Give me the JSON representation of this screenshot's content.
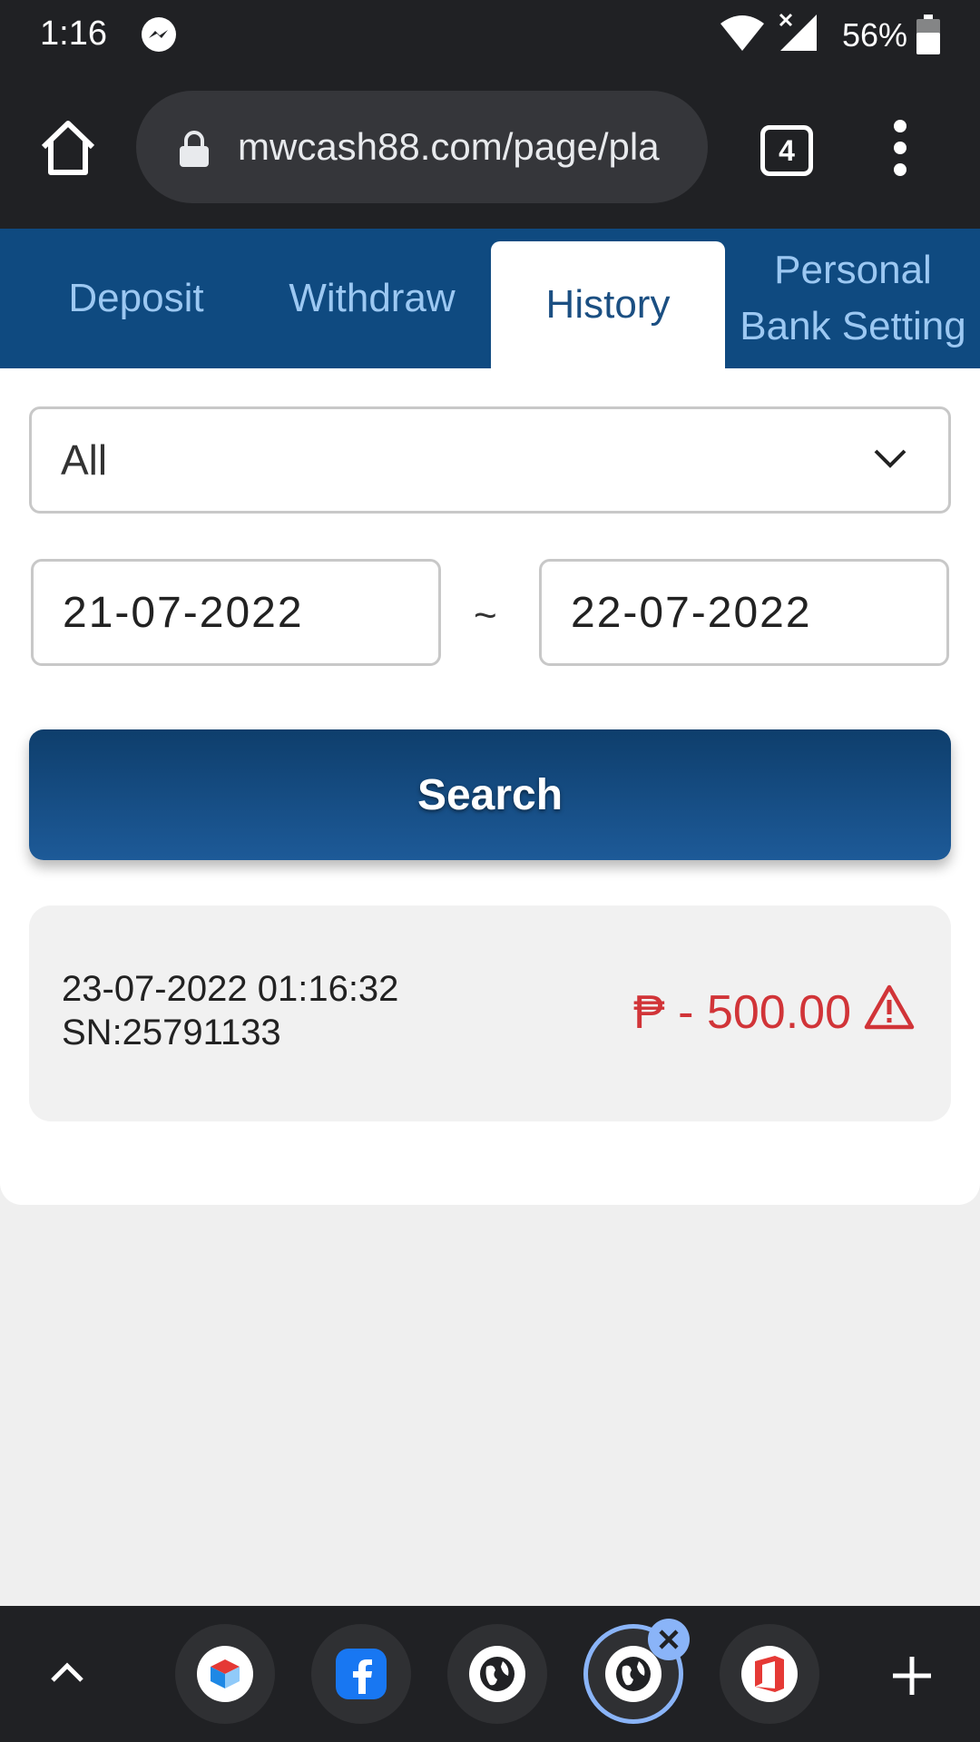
{
  "status_bar": {
    "time": "1:16",
    "battery": "56%",
    "icons": [
      "messenger-icon",
      "wifi-icon",
      "signal-icon",
      "battery-icon"
    ]
  },
  "browser": {
    "url": "mwcash88.com/page/pla",
    "tab_count": "4"
  },
  "tabs": [
    {
      "label": "Deposit",
      "active": false
    },
    {
      "label": "Withdraw",
      "active": false
    },
    {
      "label": "History",
      "active": true
    },
    {
      "label": "Personal Bank Setting",
      "active": false
    }
  ],
  "filter": {
    "type_selected": "All",
    "date_from": "21-07-2022",
    "date_separator": "~",
    "date_to": "22-07-2022",
    "search_label": "Search"
  },
  "records": [
    {
      "datetime": "23-07-2022 01:16:32",
      "sn": "SN:25791133",
      "amount": "₱ - 500.00",
      "status_icon": "warning-icon"
    }
  ],
  "colors": {
    "tab_bar": "#0f4a80",
    "active_tab_text": "#1b4f82",
    "inactive_tab_text": "#9cc8f2",
    "amount_negative": "#d13438",
    "chrome_dark": "#202124"
  },
  "bottom_bar": {
    "bubbles": [
      "vpn-app-icon",
      "facebook-icon",
      "globe-icon",
      "globe-icon",
      "office-icon"
    ]
  }
}
